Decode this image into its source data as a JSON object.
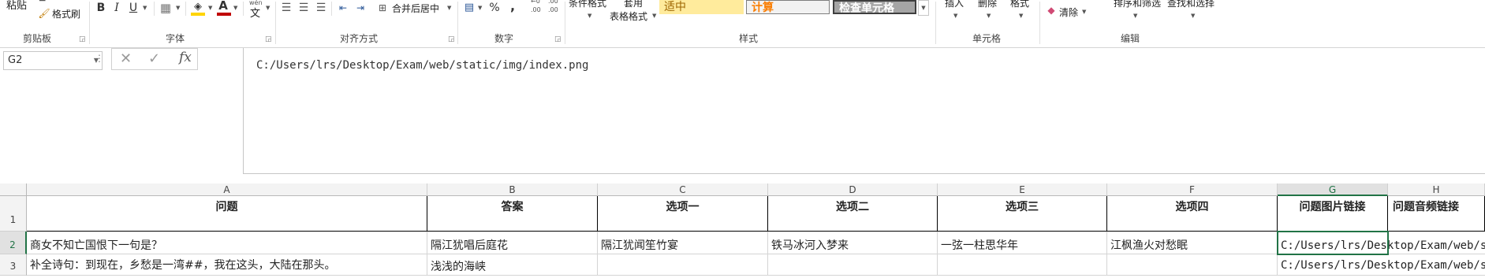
{
  "ribbon": {
    "clipboard": {
      "paste": "粘贴",
      "format_painter": "格式刷",
      "group": "剪贴板"
    },
    "font": {
      "group": "字体",
      "bold": "B",
      "italic": "I",
      "underline": "U",
      "wen": "wén",
      "wen_char": "文"
    },
    "alignment": {
      "merge_center": "合并后居中",
      "group": "对齐方式"
    },
    "number": {
      "percent": "%",
      "comma": ",",
      "inc_decimal": ".00",
      "dec_decimal": ".00",
      "group": "数字"
    },
    "styles": {
      "conditional_format": "条件格式",
      "table_format_1": "套用",
      "table_format_2": "表格格式",
      "cell_neutral": "适中",
      "cell_calc": "计算",
      "cell_check": "检查单元格",
      "group": "样式"
    },
    "cells": {
      "insert": "插入",
      "delete": "删除",
      "format": "格式",
      "group": "单元格"
    },
    "editing": {
      "clear": "清除",
      "sort_filter": "排序和筛选",
      "find_select": "查找和选择",
      "group": "编辑"
    },
    "colors": {
      "font_color": "#c00000",
      "fill_color": "#ffd400",
      "neutral_bg": "#ffeb9c",
      "neutral_fg": "#9c6500",
      "calc_bg": "#f2f2f2",
      "calc_fg": "#fa7d00",
      "check_bg": "#a5a5a5"
    }
  },
  "formula_bar": {
    "name_box": "G2",
    "cancel": "✕",
    "enter": "✓",
    "fx": "fx",
    "content": "C:/Users/lrs/Desktop/Exam/web/static/img/index.png"
  },
  "sheet": {
    "columns": [
      "A",
      "B",
      "C",
      "D",
      "E",
      "F",
      "G",
      "H"
    ],
    "rows": [
      "1",
      "2",
      "3"
    ],
    "header_row": [
      "问题",
      "答案",
      "选项一",
      "选项二",
      "选项三",
      "选项四",
      "问题图片链接",
      "问题音频链接"
    ],
    "row2": [
      "商女不知亡国恨下一句是？",
      "隔江犹唱后庭花",
      "隔江犹闻笙竹宴",
      "铁马冰河入梦来",
      "一弦一柱思华年",
      "江枫渔火对愁眠",
      "C:/Users/lrs/Desktop/Exam/web/static/img/index.png",
      ""
    ],
    "row3": [
      "补全诗句：到现在，乡愁是一湾##，我在这头，大陆在那头。",
      "浅浅的海峡",
      "",
      "",
      "",
      "",
      "C:/Users/lrs/Desktop/Exam/web/static/img/index.png",
      ""
    ]
  }
}
